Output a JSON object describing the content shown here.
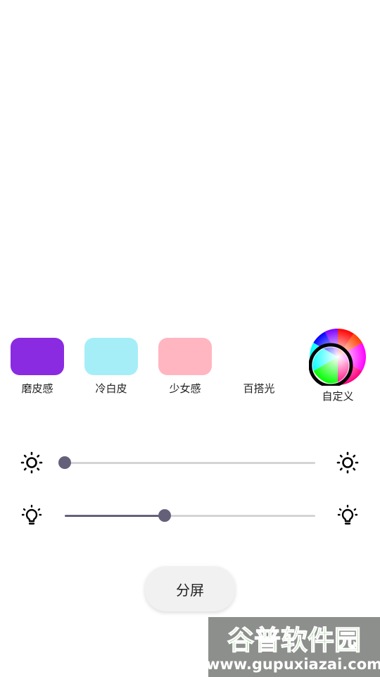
{
  "presets": [
    {
      "label": "磨皮感",
      "color": "#8a2be2"
    },
    {
      "label": "冷白皮",
      "color": "#a6eef7"
    },
    {
      "label": "少女感",
      "color": "#ffb6c1"
    },
    {
      "label": "百搭光",
      "color": "transparent"
    }
  ],
  "custom": {
    "label": "自定义",
    "icon": "color-wheel-icon"
  },
  "sliders": [
    {
      "name": "brightness",
      "icon": "sun-icon",
      "value": 0.0
    },
    {
      "name": "light-intensity",
      "icon": "bulb-icon",
      "value": 0.4
    }
  ],
  "split_button": {
    "label": "分屏"
  },
  "colors": {
    "slider_active": "#65607a",
    "slider_track": "#d4d4d6"
  },
  "watermark": {
    "title": "谷普软件园",
    "url": "www.gupuxiazai.com"
  }
}
